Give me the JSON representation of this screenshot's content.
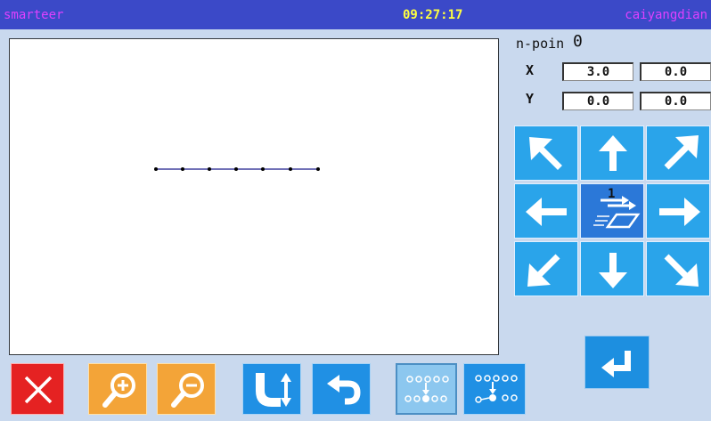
{
  "titlebar": {
    "app_name": "smarteer",
    "time": "09:27:17",
    "user": "caiyangdian"
  },
  "info": {
    "npoint_label": "n-poin",
    "npoint_value": "0",
    "x_label": "X",
    "y_label": "Y",
    "x_values": [
      "3.0",
      "0.0"
    ],
    "y_values": [
      "0.0",
      "0.0"
    ]
  },
  "dpad": {
    "center_value": "1",
    "icons": [
      "arrow-up-left-icon",
      "arrow-up-icon",
      "arrow-up-right-icon",
      "arrow-left-icon",
      "move-speed-icon",
      "arrow-right-icon",
      "arrow-down-left-icon",
      "arrow-down-icon",
      "arrow-down-right-icon"
    ]
  },
  "toolbar": {
    "icons": [
      "close-icon",
      "zoom-in-icon",
      "zoom-out-icon",
      "vertical-move-icon",
      "undo-icon",
      "stitch-pattern-icon",
      "stitch-insert-icon",
      "enter-icon"
    ]
  },
  "colors": {
    "titlebar": "#3b49c8",
    "title_text": "#e040ff",
    "time_text": "#ffff40",
    "button_blue": "#2aa4ea",
    "button_orange": "#f3a438",
    "button_red": "#e52222"
  }
}
